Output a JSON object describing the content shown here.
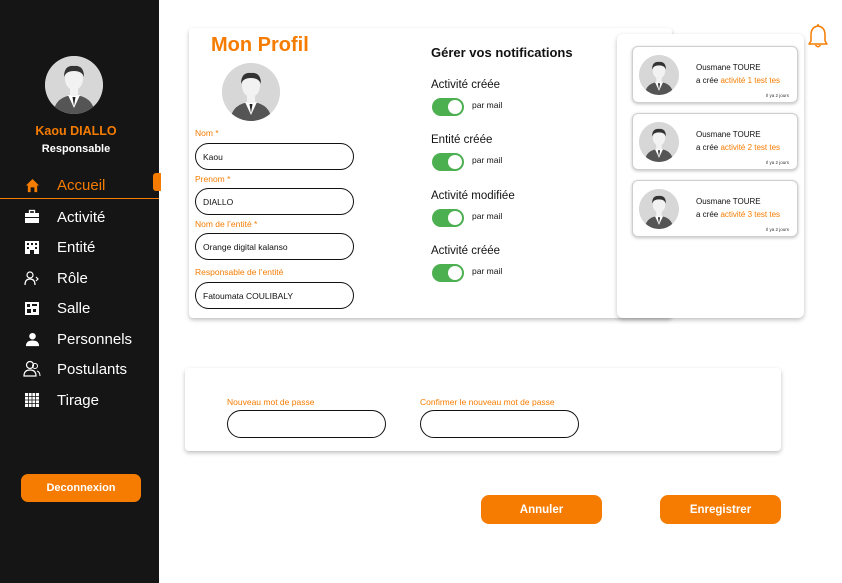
{
  "sidebar": {
    "user_name": "Kaou DIALLO",
    "user_role": "Responsable",
    "items": [
      {
        "label": "Accueil",
        "icon": "home-icon",
        "active": true
      },
      {
        "label": "Activité",
        "icon": "briefcase-icon"
      },
      {
        "label": "Entité",
        "icon": "building-icon"
      },
      {
        "label": "Rôle",
        "icon": "user-role-icon"
      },
      {
        "label": "Salle",
        "icon": "room-icon"
      },
      {
        "label": "Personnels",
        "icon": "person-icon"
      },
      {
        "label": "Postulants",
        "icon": "applicants-icon"
      },
      {
        "label": "Tirage",
        "icon": "grid-icon"
      }
    ],
    "logout_label": "Deconnexion"
  },
  "profile": {
    "title": "Mon Profil",
    "fields": [
      {
        "label": "Nom *",
        "value": "Kaou"
      },
      {
        "label": "Prenom *",
        "value": "DIALLO"
      },
      {
        "label": "Nom de l’entité *",
        "value": "Orange digital kalanso"
      },
      {
        "label": "Responsable de l’entité",
        "value": "Fatoumata COULIBALY"
      }
    ]
  },
  "notifications_settings": {
    "title": "Gérer vos notifications",
    "items": [
      {
        "label": "Activité créée",
        "toggle_label": "par mail",
        "enabled": true
      },
      {
        "label": "Entité créée",
        "toggle_label": "par mail",
        "enabled": true
      },
      {
        "label": "Activité modifiée",
        "toggle_label": "par mail",
        "enabled": true
      },
      {
        "label": "Activité créée",
        "toggle_label": "par mail",
        "enabled": true
      }
    ]
  },
  "notifications_feed": [
    {
      "name": "Ousmane TOURE",
      "action_prefix": "a crée",
      "action_link": "activité 1 test tes",
      "time": "Il ya 2 jours"
    },
    {
      "name": "Ousmane TOURE",
      "action_prefix": "a crée",
      "action_link": "activité 2 test tes",
      "time": "Il ya 2 jours"
    },
    {
      "name": "Ousmane TOURE",
      "action_prefix": "a crée",
      "action_link": "activité 3 test tes",
      "time": "Il ya 2 jours"
    }
  ],
  "password": {
    "new_label": "Nouveau mot de passe",
    "confirm_label": "Confirmer le nouveau mot de passe",
    "new_value": "",
    "confirm_value": ""
  },
  "actions": {
    "cancel_label": "Annuler",
    "save_label": "Enregistrer"
  },
  "colors": {
    "accent": "#f57c00",
    "sidebar_bg": "#151515",
    "toggle_on": "#4caf50"
  }
}
